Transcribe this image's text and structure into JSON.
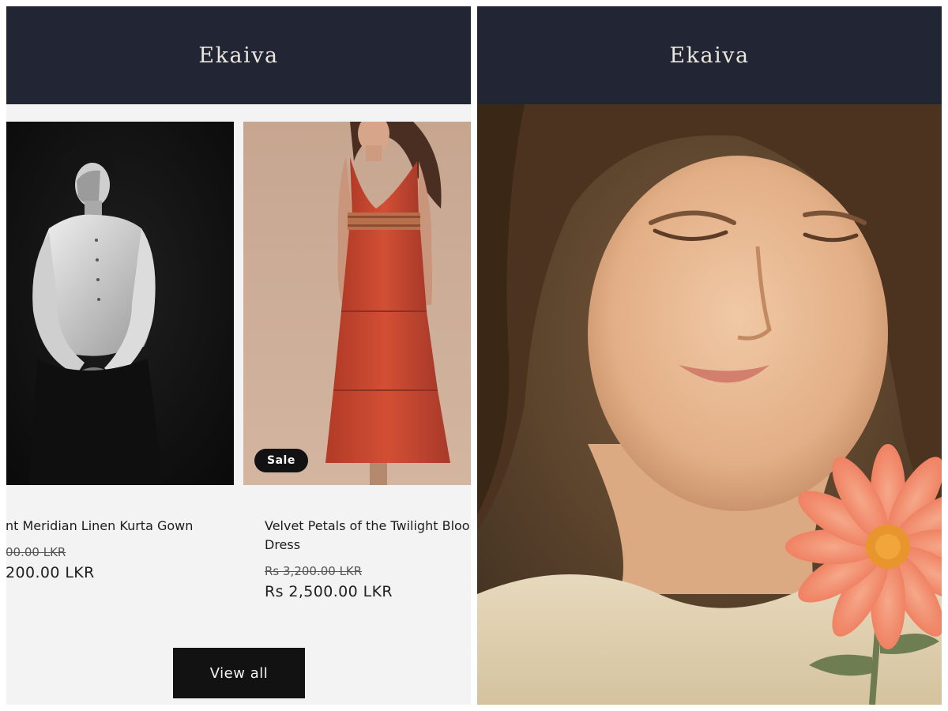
{
  "left_screen": {
    "header": {
      "logo_text": "Ekaiva"
    },
    "products": [
      {
        "title": "nt Meridian Linen Kurta Gown",
        "old_price": "00.00 LKR",
        "new_price": "200.00 LKR",
        "image": "man in white shirt on black background"
      },
      {
        "title": "Velvet Petals of the Twilight Bloo\nDress",
        "old_price": "Rs 3,200.00 LKR",
        "new_price": "Rs 2,500.00 LKR",
        "badge": "Sale",
        "image": "woman in red tiered maxi dress"
      }
    ],
    "view_all_label": "View all"
  },
  "right_screen": {
    "header": {
      "logo_text": "Ekaiva"
    },
    "hero_image": "painted portrait of a young woman with an orange flower"
  },
  "colors": {
    "header_bg": "#222634",
    "logo": "#e9e6df",
    "page_bg": "#f3f3f4",
    "button_bg": "#121212",
    "dress": "#c9472f"
  }
}
